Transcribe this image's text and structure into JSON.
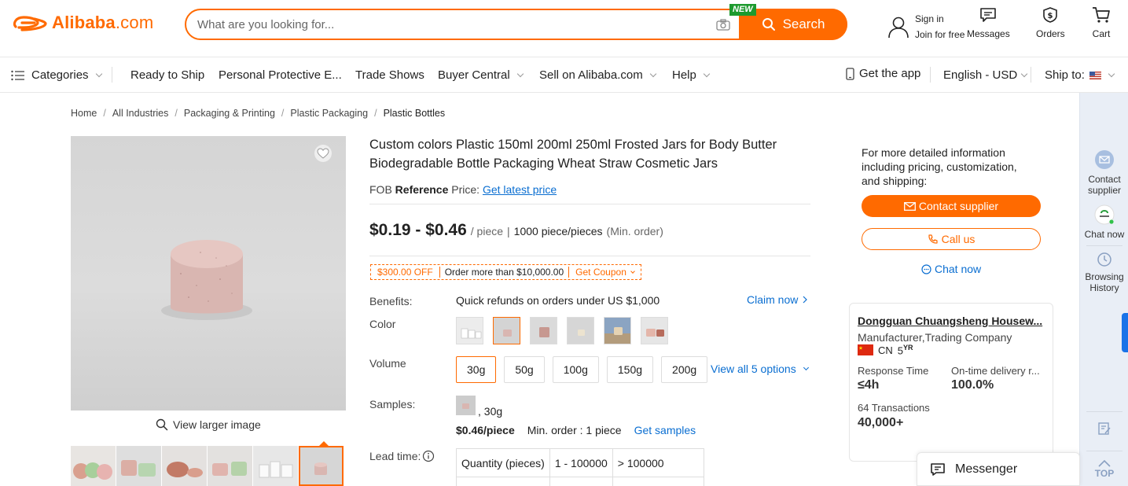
{
  "brand": {
    "logo_text": "Alibaba",
    "logo_suffix": ".com"
  },
  "search": {
    "placeholder": "What are you looking for...",
    "button_label": "Search",
    "new_badge": "NEW"
  },
  "header": {
    "signin_line1": "Sign in",
    "signin_line2": "Join for free",
    "messages": "Messages",
    "orders": "Orders",
    "cart": "Cart"
  },
  "nav": {
    "categories": "Categories",
    "items": [
      "Ready to Ship",
      "Personal Protective E...",
      "Trade Shows",
      "Buyer Central",
      "Sell on Alibaba.com",
      "Help"
    ],
    "get_app": "Get the app",
    "language": "English - USD",
    "ship_to": "Ship to:"
  },
  "breadcrumb": [
    "Home",
    "All Industries",
    "Packaging & Printing",
    "Plastic Packaging",
    "Plastic Bottles"
  ],
  "gallery": {
    "view_larger": "View larger image"
  },
  "product": {
    "title": "Custom colors Plastic 150ml 200ml 250ml Frosted Jars for Body Butter Biodegradable Bottle Packaging Wheat Straw Cosmetic Jars",
    "fob_prefix": "FOB",
    "fob_bold": "Reference",
    "fob_suffix": "Price:",
    "fob_link": "Get latest price",
    "price": "$0.19 - $0.46",
    "price_unit": "/ piece",
    "pipe": "|",
    "min_order": "1000 piece/pieces",
    "min_order_note": "(Min. order)",
    "coupon": {
      "amount": "$300.00 OFF",
      "condition": "Order more than $10,000.00",
      "action": "Get Coupon"
    },
    "benefits_label": "Benefits:",
    "benefits_value": "Quick refunds on orders under US $1,000",
    "claim": "Claim now",
    "color_label": "Color",
    "volume_label": "Volume",
    "volumes": [
      "30g",
      "50g",
      "100g",
      "150g",
      "200g"
    ],
    "view_all": "View all 5 options",
    "samples_label": "Samples:",
    "sample_variant": ", 30g",
    "sample_price": "$0.46/piece",
    "sample_min": "Min. order : 1 piece",
    "get_samples": "Get samples",
    "lead_label": "Lead time:",
    "lead_table_header": [
      "Quantity (pieces)",
      "1 - 100000",
      "> 100000"
    ]
  },
  "contact": {
    "info_text": "For more detailed information including pricing, customization, and shipping:",
    "contact_btn": "Contact supplier",
    "call_btn": "Call us",
    "chat_link": "Chat now"
  },
  "supplier": {
    "name": "Dongguan Chuangsheng Housew...",
    "type": "Manufacturer,Trading Company",
    "country": "CN",
    "years": "5",
    "years_suffix": "YR",
    "response_label": "Response Time",
    "response_value": "≤4h",
    "ontime_label": "On-time delivery r...",
    "ontime_value": "100.0%",
    "transactions_label": "64 Transactions",
    "transactions_value": "40,000+"
  },
  "rail": {
    "contact": "Contact supplier",
    "chat": "Chat now",
    "history": "Browsing History",
    "top": "TOP"
  },
  "messenger": {
    "label": "Messenger"
  },
  "colors": {
    "accent": "#ff6a00",
    "link": "#0a6ed1",
    "new_badge": "#1d9a2e"
  }
}
